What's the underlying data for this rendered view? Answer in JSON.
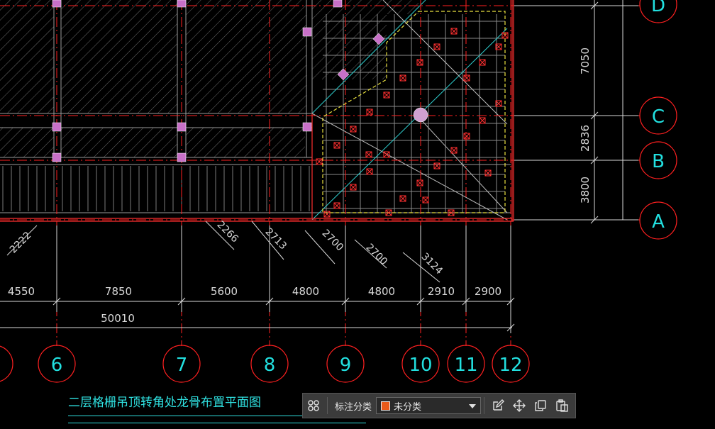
{
  "drawing": {
    "title": "二层格栅吊顶转角处龙骨布置平面图",
    "colors": {
      "background": "#000000",
      "axis_red": "#ff2020",
      "bubble_cyan": "#22e0e0",
      "dim_white": "#d8d8d8",
      "hatch_gray": "#8a8a8a",
      "node_magenta": "#e070e0",
      "border_yellow": "#e8e040"
    },
    "axis_bubbles_bottom": [
      "6",
      "7",
      "8",
      "9",
      "10",
      "11",
      "12"
    ],
    "axis_bubbles_right": [
      "D",
      "C",
      "B",
      "A"
    ],
    "dims_bottom": [
      "4550",
      "7850",
      "5600",
      "4800",
      "4800",
      "2910",
      "2900"
    ],
    "dim_total": "50010",
    "dims_right": [
      "7050",
      "2836",
      "3800"
    ],
    "dims_diagonal": [
      "2222",
      "2266",
      "2713",
      "2700",
      "2700",
      "3124"
    ]
  },
  "toolbar": {
    "label": "标注分类",
    "select_value": "未分类",
    "select_swatch_color": "#e85a1a",
    "icons": [
      "grid-icon",
      "edit-icon",
      "move-icon",
      "copy-icon",
      "paste-icon"
    ]
  }
}
